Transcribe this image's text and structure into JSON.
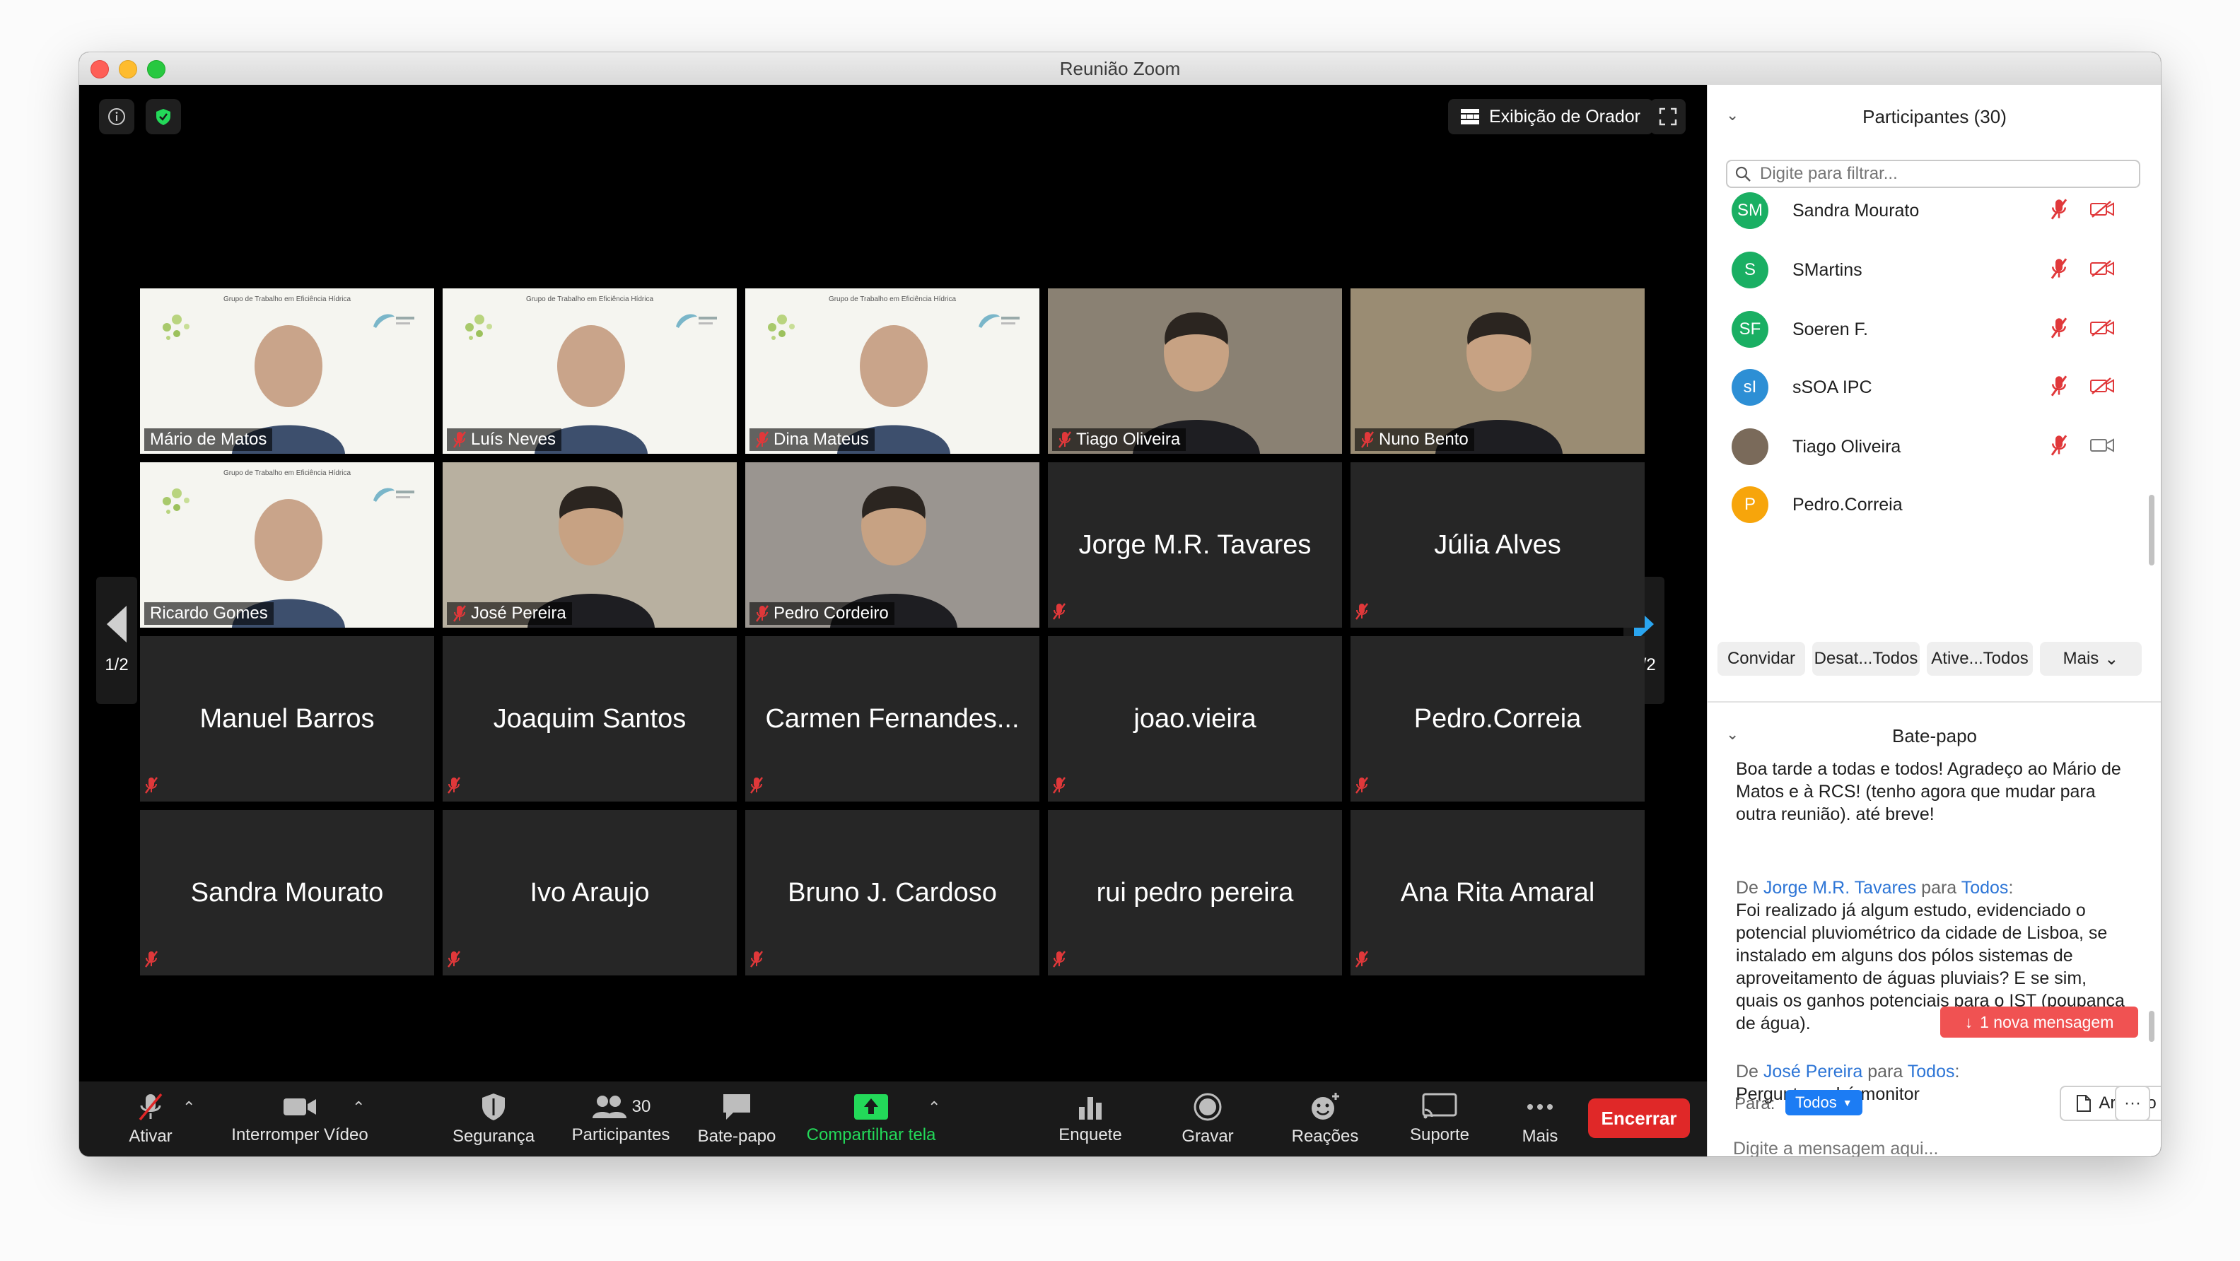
{
  "window": {
    "title": "Reunião Zoom"
  },
  "top_bar": {
    "speaker_view_label": "Exibição de Orador"
  },
  "pagination": {
    "left_page": "1/2",
    "right_page": "1/2"
  },
  "tiles": [
    {
      "name": "Mário de Matos",
      "kind": "slide",
      "muted": false,
      "active": true,
      "slide_heading": "Grupo de Trabalho em Eficiência Hídrica"
    },
    {
      "name": "Luís Neves",
      "kind": "slide",
      "muted": true,
      "active": false,
      "slide_heading": "Grupo de Trabalho em Eficiência Hídrica"
    },
    {
      "name": "Dina Mateus",
      "kind": "slide",
      "muted": true,
      "active": false,
      "slide_heading": "Grupo de Trabalho em Eficiência Hídrica"
    },
    {
      "name": "Tiago Oliveira",
      "kind": "photo",
      "muted": true,
      "active": false,
      "bg": "#8a8173"
    },
    {
      "name": "Nuno Bento",
      "kind": "photo",
      "muted": true,
      "active": false,
      "bg": "#9a8c73"
    },
    {
      "name": "Ricardo Gomes",
      "kind": "slide",
      "muted": false,
      "active": false,
      "slide_heading": "Grupo de Trabalho em Eficiência Hídrica"
    },
    {
      "name": "José Pereira",
      "kind": "photo",
      "muted": true,
      "active": false,
      "bg": "#b8b0a0"
    },
    {
      "name": "Pedro Cordeiro",
      "kind": "photo",
      "muted": true,
      "active": false,
      "bg": "#9a9590"
    },
    {
      "name": "Jorge M.R. Tavares",
      "kind": "name",
      "muted": true,
      "active": false
    },
    {
      "name": "Júlia Alves",
      "kind": "name",
      "muted": true,
      "active": false
    },
    {
      "name": "Manuel Barros",
      "kind": "name",
      "muted": true,
      "active": false
    },
    {
      "name": "Joaquim Santos",
      "kind": "name",
      "muted": true,
      "active": false
    },
    {
      "name": "Carmen Fernandes...",
      "kind": "name",
      "muted": true,
      "active": false
    },
    {
      "name": "joao.vieira",
      "kind": "name",
      "muted": true,
      "active": false
    },
    {
      "name": "Pedro.Correia",
      "kind": "name",
      "muted": true,
      "active": false
    },
    {
      "name": "Sandra Mourato",
      "kind": "name",
      "muted": true,
      "active": false
    },
    {
      "name": "Ivo Araujo",
      "kind": "name",
      "muted": true,
      "active": false
    },
    {
      "name": "Bruno J. Cardoso",
      "kind": "name",
      "muted": true,
      "active": false
    },
    {
      "name": "rui pedro pereira",
      "kind": "name",
      "muted": true,
      "active": false
    },
    {
      "name": "Ana Rita Amaral",
      "kind": "name",
      "muted": true,
      "active": false
    }
  ],
  "toolbar": {
    "mute_label": "Ativar",
    "video_label": "Interromper Vídeo",
    "security_label": "Segurança",
    "participants_label": "Participantes",
    "participants_count": "30",
    "chat_label": "Bate-papo",
    "share_label": "Compartilhar tela",
    "poll_label": "Enquete",
    "record_label": "Gravar",
    "reactions_label": "Reações",
    "support_label": "Suporte",
    "more_label": "Mais",
    "end_label": "Encerrar"
  },
  "participants_panel": {
    "title": "Participantes (30)",
    "filter_placeholder": "Digite para filtrar...",
    "items": [
      {
        "initials": "SM",
        "name": "Sandra Mourato",
        "color": "#1aaf63",
        "video": "off"
      },
      {
        "initials": "S",
        "name": "SMartins",
        "color": "#1aaf63",
        "video": "off"
      },
      {
        "initials": "SF",
        "name": "Soeren F.",
        "color": "#1aaf63",
        "video": "off"
      },
      {
        "initials": "sI",
        "name": "sSOA IPC",
        "color": "#2d8fd5",
        "video": "off"
      },
      {
        "initials": "",
        "name": "Tiago Oliveira",
        "color": "#7a6a5a",
        "video": "on"
      },
      {
        "initials": "P",
        "name": "Pedro.Correia",
        "color": "#f7a50b",
        "video": "none"
      }
    ],
    "actions": {
      "invite": "Convidar",
      "mute_all": "Desat...Todos",
      "unmute_all": "Ative...Todos",
      "more": "Mais"
    }
  },
  "chat_panel": {
    "title": "Bate-papo",
    "messages": [
      {
        "from": "",
        "to": "",
        "text": "Boa tarde a todas e todos! Agradeço ao Mário de Matos e à RCS! (tenho agora que mudar para outra reunião). até breve!"
      },
      {
        "from": "Jorge M.R. Tavares",
        "to": "Todos",
        "text": "Foi realizado já algum estudo, evidenciado o potencial pluviométrico da cidade de Lisboa, se instalado em alguns dos pólos sistemas de aproveitamento de águas pluviais? E se sim, quais os ganhos potenciais para o IST  (poupança de água)."
      },
      {
        "from": "José Pereira",
        "to": "Todos",
        "text": "Pergunto se há monitor"
      }
    ],
    "prefix_from": "De",
    "prefix_to": "para",
    "new_message_label": "1 nova mensagem",
    "to_label": "Para:",
    "to_value": "Todos",
    "file_label": "Arquivo",
    "input_placeholder": "Digite a mensagem aqui..."
  },
  "colors": {
    "active_speaker": "#e6ef6b",
    "end_button": "#e02828",
    "share_green": "#23d959",
    "chat_link": "#2d75d6",
    "toolbar_bg": "#1a1a1a"
  }
}
